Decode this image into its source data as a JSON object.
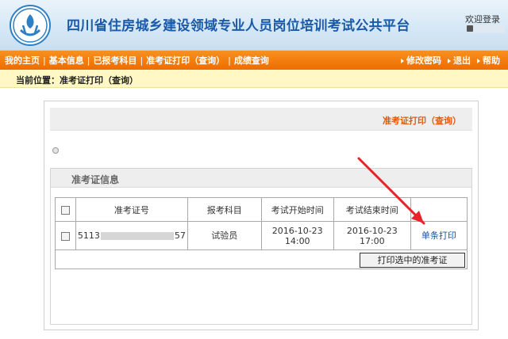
{
  "header": {
    "site_title": "四川省住房城乡建设领域专业人员岗位培训考试公共平台",
    "welcome_text": "欢迎登录"
  },
  "nav": {
    "left_items": [
      "我的主页",
      "基本信息",
      "已报考科目",
      "准考证打印（查询）",
      "成绩查询"
    ],
    "right_items": [
      "修改密码",
      "退出",
      "帮助"
    ]
  },
  "location": {
    "text": "当前位置：准考证打印（查询）"
  },
  "panel": {
    "title": "准考证打印（查询）",
    "section_title": "准考证信息"
  },
  "table": {
    "headers": [
      "准考证号",
      "报考科目",
      "考试开始时间",
      "考试结束时间"
    ],
    "rows": [
      {
        "id_prefix": "5113",
        "id_suffix": "57",
        "subject": "试验员",
        "start_date": "2016-10-23",
        "start_time": "14:00",
        "end_date": "2016-10-23",
        "end_time": "17:00",
        "action": "单条打印"
      }
    ],
    "print_selected_label": "打印选中的准考证"
  },
  "colors": {
    "header_blue": "#1a5aa8",
    "nav_orange": "#ef6c00",
    "location_bg": "#fff7c4",
    "panel_title_orange": "#e05a0c",
    "link_blue": "#1b52a6",
    "arrow_red": "#e8232b"
  },
  "icons": {
    "logo": "housing-construction-logo",
    "nav_bullet": "triangle-right-icon"
  }
}
